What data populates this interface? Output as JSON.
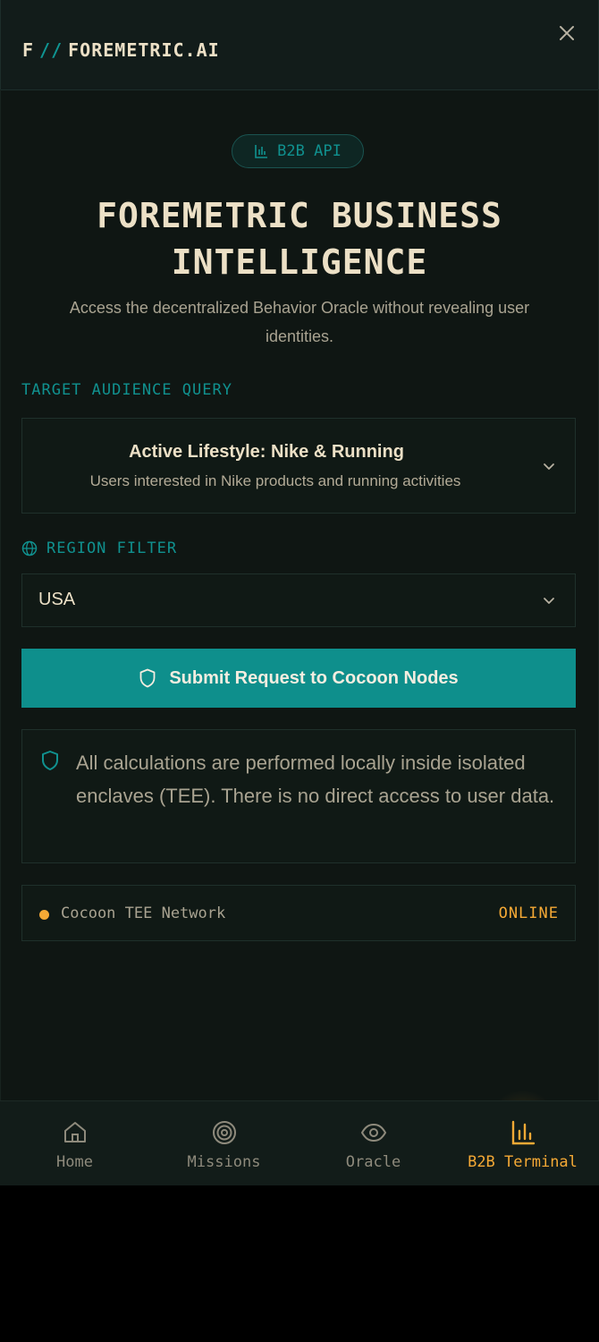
{
  "header": {
    "brand_letter": "F",
    "brand_separator": "//",
    "brand_name": "FOREMETRIC.AI",
    "close_icon": "close-icon"
  },
  "badge": {
    "icon": "bar-chart-icon",
    "label": "B2B API"
  },
  "hero": {
    "title_line1": "FOREMETRIC BUSINESS",
    "title_line2": "INTELLIGENCE",
    "subtitle": "Access the decentralized Behavior Oracle without revealing user identities."
  },
  "audience": {
    "label": "TARGET AUDIENCE QUERY",
    "selected_title": "Active Lifestyle: Nike & Running",
    "selected_desc": "Users interested in Nike products and running activities"
  },
  "region": {
    "icon": "globe-icon",
    "label": "REGION FILTER",
    "selected": "USA"
  },
  "submit": {
    "icon": "shield-icon",
    "label": "Submit Request to Cocoon Nodes"
  },
  "notice": {
    "icon": "shield-icon",
    "text": "All calculations are performed locally inside isolated enclaves (TEE). There is no direct access to user data."
  },
  "status": {
    "name": "Cocoon TEE Network",
    "value": "ONLINE",
    "color": "#f5a935"
  },
  "nav": {
    "items": [
      {
        "label": "Home",
        "icon": "home-icon"
      },
      {
        "label": "Missions",
        "icon": "target-icon"
      },
      {
        "label": "Oracle",
        "icon": "eye-icon"
      },
      {
        "label": "B2B Terminal",
        "icon": "bar-chart-icon",
        "active": true
      }
    ]
  },
  "colors": {
    "accent_teal": "#0e8f8c",
    "accent_orange": "#f5a935",
    "background": "#0f1613",
    "text_light": "#ece0c6"
  }
}
